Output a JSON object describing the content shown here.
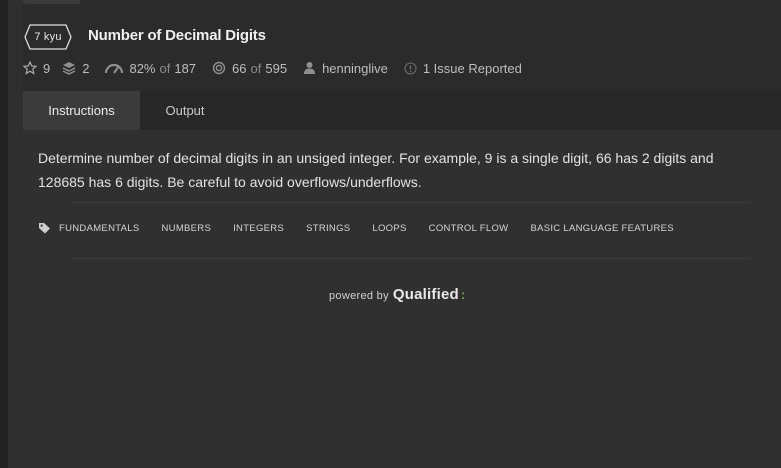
{
  "kata": {
    "rank": "7 kyu",
    "title": "Number of Decimal Digits",
    "stars": "9",
    "collections": "2",
    "satisfaction_pct": "82%",
    "satisfaction_of": "of",
    "satisfaction_votes": "187",
    "completed": "66",
    "completed_of": "of",
    "attempts": "595",
    "author": "henninglive",
    "issues": "1 Issue Reported"
  },
  "tabs": [
    {
      "label": "Instructions",
      "active": true
    },
    {
      "label": "Output",
      "active": false
    }
  ],
  "description": "Determine number of decimal digits in an unsiged integer. For example, 9 is a single digit, 66 has 2 digits and 128685 has 6 digits. Be careful to avoid overflows/underflows.",
  "tags": [
    "FUNDAMENTALS",
    "NUMBERS",
    "INTEGERS",
    "STRINGS",
    "LOOPS",
    "CONTROL FLOW",
    "BASIC LANGUAGE FEATURES"
  ],
  "powered_by": {
    "prefix": "powered by",
    "brand": "Qualified",
    "mark": ":"
  },
  "colors": {
    "background": "#2b2b2b",
    "panel": "#303030",
    "tab_active": "#3b3b3b",
    "accent": "#6aa84f"
  },
  "icons": {
    "star": "star-icon",
    "collection": "layers-icon",
    "satisfaction": "gauge-icon",
    "completed": "target-icon",
    "author": "user-icon",
    "issues": "alert-icon",
    "tag": "tag-icon"
  }
}
